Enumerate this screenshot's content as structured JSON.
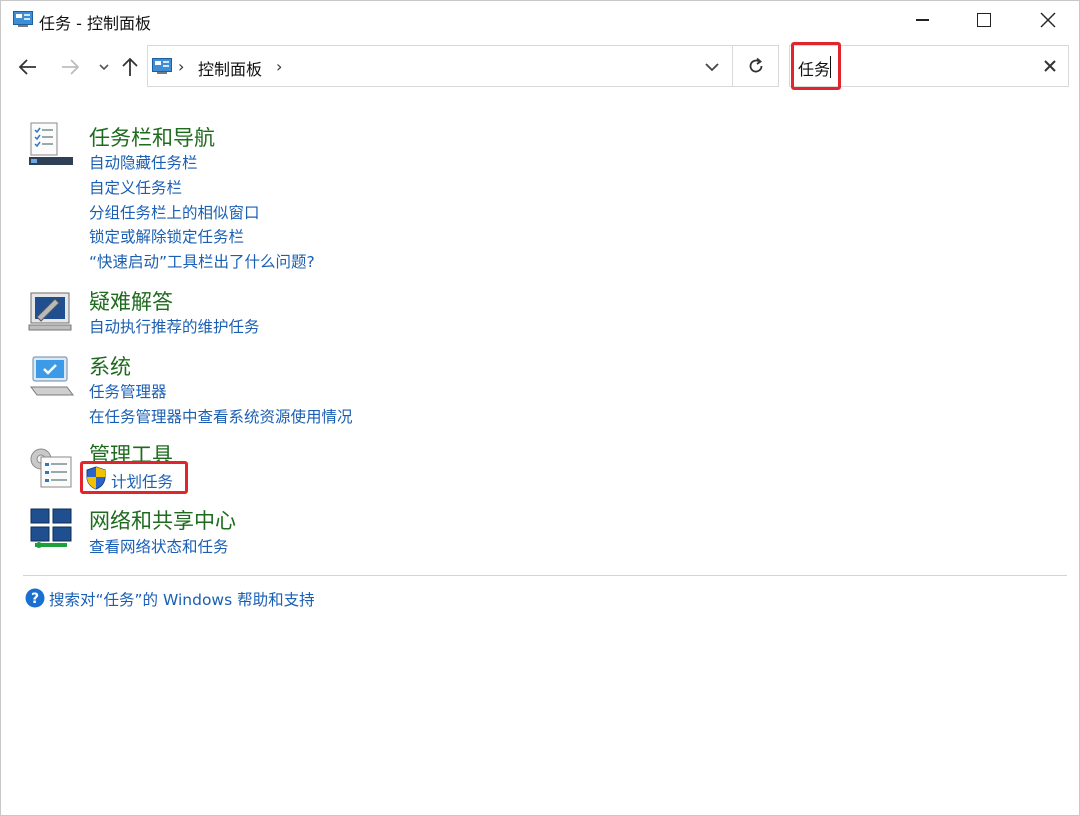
{
  "window": {
    "title": "任务 - 控制面板"
  },
  "address_bar": {
    "path": "控制面板"
  },
  "search": {
    "value": "任务"
  },
  "results": [
    {
      "title": "任务栏和导航",
      "icon": "taskbar-settings-icon",
      "links": [
        "自动隐藏任务栏",
        "自定义任务栏",
        "分组任务栏上的相似窗口",
        "锁定或解除锁定任务栏",
        "“快速启动”工具栏出了什么问题?"
      ]
    },
    {
      "title": "疑难解答",
      "icon": "troubleshooting-icon",
      "links": [
        "自动执行推荐的维护任务"
      ]
    },
    {
      "title": "系统",
      "icon": "computer-icon",
      "links": [
        "任务管理器",
        "在任务管理器中查看系统资源使用情况"
      ]
    },
    {
      "title": "管理工具",
      "icon": "admin-tools-icon",
      "links": [
        "计划任务"
      ]
    },
    {
      "title": "网络和共享中心",
      "icon": "network-icon",
      "links": [
        "查看网络状态和任务"
      ]
    }
  ],
  "help": {
    "text": "搜索对“任务”的 Windows 帮助和支持"
  },
  "colors": {
    "group_title": "#1e6b1e",
    "link": "#1a5fb4",
    "highlight": "#e0262c"
  }
}
